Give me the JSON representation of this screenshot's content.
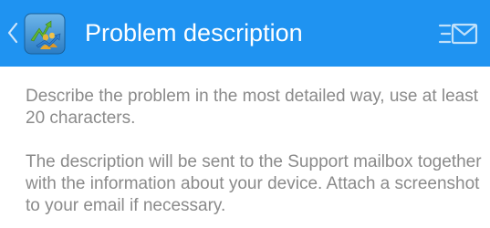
{
  "header": {
    "title": "Problem description",
    "back_icon": "chevron-left-icon",
    "logo_icon": "metatrader-logo-icon",
    "send_icon": "send-email-icon",
    "bar_color": "#1f93f1"
  },
  "main": {
    "paragraphs": [
      "Describe the problem in the most detailed way, use at least 20 characters.",
      "The description will be sent to the Support mailbox together with the information about your device. Attach a screenshot to your email if necessary."
    ],
    "text_color": "#8a8a8a"
  }
}
